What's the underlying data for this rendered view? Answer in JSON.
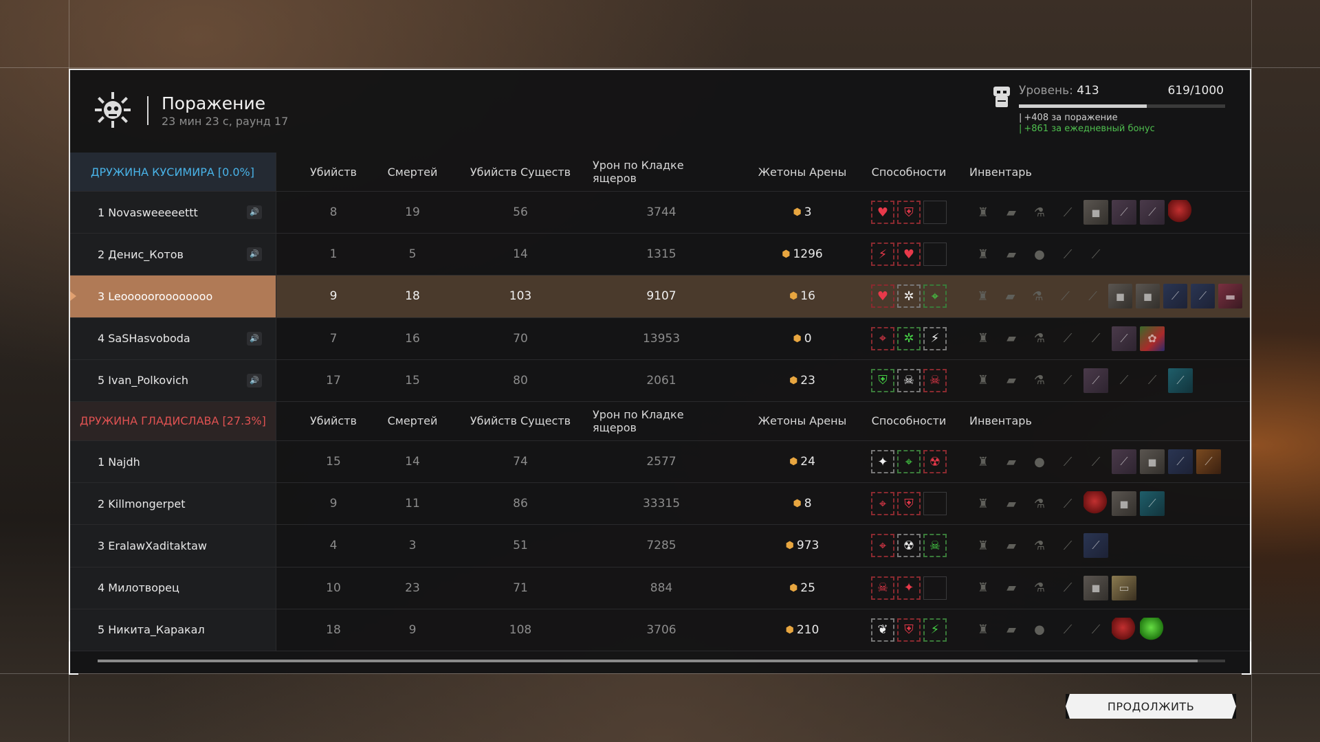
{
  "header": {
    "title": "Поражение",
    "subtitle": "23 мин 23 с, раунд 17",
    "level_label": "Уровень:",
    "level_value": "413",
    "xp_text": "619/1000",
    "xp_progress": 0.619,
    "bonus_defeat": "+408 за поражение",
    "bonus_daily": "+861 за ежедневный бонус"
  },
  "columns": {
    "kills": "Убийств",
    "deaths": "Смертей",
    "creature_kills": "Убийств Существ",
    "lizard_damage": "Урон по Кладке ящеров",
    "arena_tokens": "Жетоны Арены",
    "abilities": "Способности",
    "inventory": "Инвентарь"
  },
  "teams": [
    {
      "name": "ДРУЖИНА КУСИМИРА [0.0%]",
      "color": "#49b3e8",
      "players": [
        {
          "name": "1 Novasweeeeettt",
          "kills": "8",
          "deaths": "19",
          "creature_kills": "56",
          "lizard_damage": "3744",
          "tokens": "3",
          "speaker": true,
          "abilities": [
            {
              "c": "red",
              "i": "heart"
            },
            {
              "c": "red",
              "i": "shield"
            },
            {
              "c": "empty",
              "i": ""
            }
          ],
          "inventory": [
            "armor",
            "ammo",
            "bottle",
            "blade",
            "stone",
            "purple",
            "purple",
            "red"
          ]
        },
        {
          "name": "2 Денис_Котов",
          "kills": "1",
          "deaths": "5",
          "creature_kills": "14",
          "lizard_damage": "1315",
          "tokens": "1296",
          "speaker": true,
          "abilities": [
            {
              "c": "red",
              "i": "bolt"
            },
            {
              "c": "red",
              "i": "heart"
            },
            {
              "c": "empty",
              "i": ""
            }
          ],
          "inventory": [
            "armor",
            "ammo",
            "grenade",
            "blade",
            "axe"
          ]
        },
        {
          "name": "3 Leoooooroooooooo",
          "kills": "9",
          "deaths": "18",
          "creature_kills": "103",
          "lizard_damage": "9107",
          "tokens": "16",
          "speaker": false,
          "highlight": true,
          "abilities": [
            {
              "c": "red",
              "i": "heart"
            },
            {
              "c": "white",
              "i": "gear"
            },
            {
              "c": "green",
              "i": "target"
            }
          ],
          "inventory": [
            "armor",
            "ammo",
            "bottle",
            "rifle",
            "blade",
            "stone",
            "stone",
            "blue",
            "blue",
            "pink"
          ]
        },
        {
          "name": "4 SaSHasvoboda",
          "kills": "7",
          "deaths": "16",
          "creature_kills": "70",
          "lizard_damage": "13953",
          "tokens": "0",
          "speaker": true,
          "abilities": [
            {
              "c": "red",
              "i": "target"
            },
            {
              "c": "green",
              "i": "gear"
            },
            {
              "c": "white",
              "i": "bolt"
            }
          ],
          "inventory": [
            "armor",
            "ammo",
            "bottle",
            "rifle",
            "axe",
            "purple",
            "multi"
          ]
        },
        {
          "name": "5 Ivan_Polkovich",
          "kills": "17",
          "deaths": "15",
          "creature_kills": "80",
          "lizard_damage": "2061",
          "tokens": "23",
          "speaker": true,
          "abilities": [
            {
              "c": "green",
              "i": "shield"
            },
            {
              "c": "white",
              "i": "skull"
            },
            {
              "c": "red",
              "i": "skull"
            }
          ],
          "inventory": [
            "armor",
            "ammo",
            "bottle",
            "blade",
            "purple",
            "blade",
            "blade",
            "teal"
          ]
        }
      ]
    },
    {
      "name": "ДРУЖИНА ГЛАДИСЛАВА [27.3%]",
      "color": "#e05252",
      "players": [
        {
          "name": "1 Najdh",
          "kills": "15",
          "deaths": "14",
          "creature_kills": "74",
          "lizard_damage": "2577",
          "tokens": "24",
          "speaker": false,
          "abilities": [
            {
              "c": "white",
              "i": "wing"
            },
            {
              "c": "green",
              "i": "target"
            },
            {
              "c": "red",
              "i": "rad"
            }
          ],
          "inventory": [
            "armor",
            "ammo",
            "grenade",
            "blade",
            "axe",
            "purple",
            "stone",
            "blue",
            "orange"
          ]
        },
        {
          "name": "2 Killmongerpet",
          "kills": "9",
          "deaths": "11",
          "creature_kills": "86",
          "lizard_damage": "33315",
          "tokens": "8",
          "speaker": false,
          "abilities": [
            {
              "c": "red",
              "i": "target"
            },
            {
              "c": "red",
              "i": "shield"
            },
            {
              "c": "empty",
              "i": ""
            }
          ],
          "inventory": [
            "armor",
            "ammo",
            "bottle",
            "rifle",
            "red",
            "stone",
            "teal"
          ]
        },
        {
          "name": "3 EralawXaditaktaw",
          "kills": "4",
          "deaths": "3",
          "creature_kills": "51",
          "lizard_damage": "7285",
          "tokens": "973",
          "speaker": false,
          "abilities": [
            {
              "c": "red",
              "i": "target"
            },
            {
              "c": "white",
              "i": "rad"
            },
            {
              "c": "green",
              "i": "skull"
            }
          ],
          "inventory": [
            "armor",
            "ammo",
            "bottle",
            "blade",
            "blue"
          ]
        },
        {
          "name": "4 Милотворец",
          "kills": "10",
          "deaths": "23",
          "creature_kills": "71",
          "lizard_damage": "884",
          "tokens": "25",
          "speaker": false,
          "abilities": [
            {
              "c": "red",
              "i": "skull"
            },
            {
              "c": "red",
              "i": "wing"
            },
            {
              "c": "empty",
              "i": ""
            }
          ],
          "inventory": [
            "armor",
            "ammo",
            "bottle",
            "blade",
            "stone",
            "paper"
          ]
        },
        {
          "name": "5 Никита_Каракал",
          "kills": "18",
          "deaths": "9",
          "creature_kills": "108",
          "lizard_damage": "3706",
          "tokens": "210",
          "speaker": false,
          "abilities": [
            {
              "c": "white",
              "i": "drop"
            },
            {
              "c": "red",
              "i": "shield"
            },
            {
              "c": "green",
              "i": "bolt"
            }
          ],
          "inventory": [
            "armor",
            "ammo",
            "grenade",
            "blade",
            "axe",
            "red",
            "green"
          ]
        }
      ]
    }
  ],
  "continue_button": "ПРОДОЛЖИТЬ",
  "icons": {
    "heart": "♥",
    "shield": "⛨",
    "bolt": "⚡",
    "gear": "✲",
    "target": "⌖",
    "skull": "☠",
    "rad": "☢",
    "wing": "✦",
    "drop": "❦",
    "armor": "♜",
    "ammo": "▰",
    "bottle": "⚗",
    "grenade": "●",
    "blade": "⟋",
    "rifle": "⟋",
    "axe": "⟋",
    "stone": "◼",
    "purple": "⟋",
    "blue": "⟋",
    "teal": "⟋",
    "orange": "⟋",
    "pink": "▬",
    "paper": "▭",
    "red": "",
    "green": "",
    "multi": "✿"
  }
}
